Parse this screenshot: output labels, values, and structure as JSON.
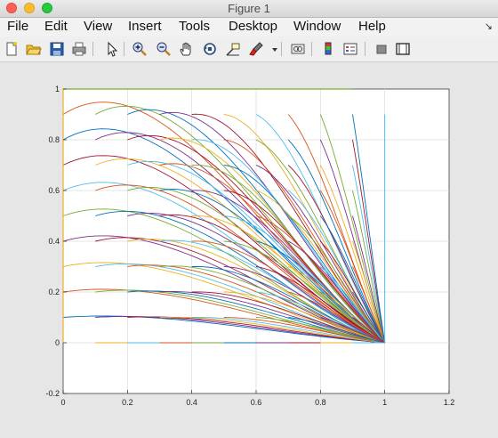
{
  "window": {
    "title": "Figure 1"
  },
  "menu": [
    "File",
    "Edit",
    "View",
    "Insert",
    "Tools",
    "Desktop",
    "Window",
    "Help"
  ],
  "menu_corner": "↘",
  "toolbar": [
    "new-figure-icon",
    "open-file-icon",
    "save-icon",
    "print-icon",
    "pointer-icon",
    "zoom-in-icon",
    "zoom-out-icon",
    "pan-hand-icon",
    "rotate-3d-icon",
    "data-cursor-icon",
    "brush-icon",
    "brush-dropdown-icon",
    "link-plot-icon",
    "colorbar-icon",
    "legend-icon",
    "hide-plot-tools-icon",
    "show-plot-tools-icon"
  ],
  "chart_data": {
    "type": "line",
    "xlim": [
      0,
      1.2
    ],
    "ylim": [
      -0.2,
      1
    ],
    "xticks": [
      "0",
      "0.2",
      "0.4",
      "0.6",
      "0.8",
      "1",
      "1.2"
    ],
    "yticks": [
      "-0.2",
      "0",
      "0.2",
      "0.4",
      "0.6",
      "0.8",
      "1"
    ],
    "grid": true,
    "title": "",
    "xlabel": "",
    "ylabel": "",
    "colors": [
      "#0072bd",
      "#d95319",
      "#edb120",
      "#7e2f8e",
      "#77ac30",
      "#4dbeee",
      "#a2142f"
    ],
    "description_of_series": "family of trajectory curves from starting points (x0, y0) with x0 in {0.1,...,0.9}, y0 in {0,0.1,...,0.9}, each converging to the point (1, 0); plus a vertical line at x=1 from y=0 to y=0.9 and a horizontal line at y=1",
    "converge_point": [
      1,
      0
    ],
    "start_x": [
      0,
      0.1,
      0.2,
      0.3,
      0.4,
      0.5,
      0.6,
      0.7,
      0.8,
      0.9
    ],
    "start_y": [
      0,
      0.1,
      0.2,
      0.3,
      0.4,
      0.5,
      0.6,
      0.7,
      0.8,
      0.9
    ]
  }
}
